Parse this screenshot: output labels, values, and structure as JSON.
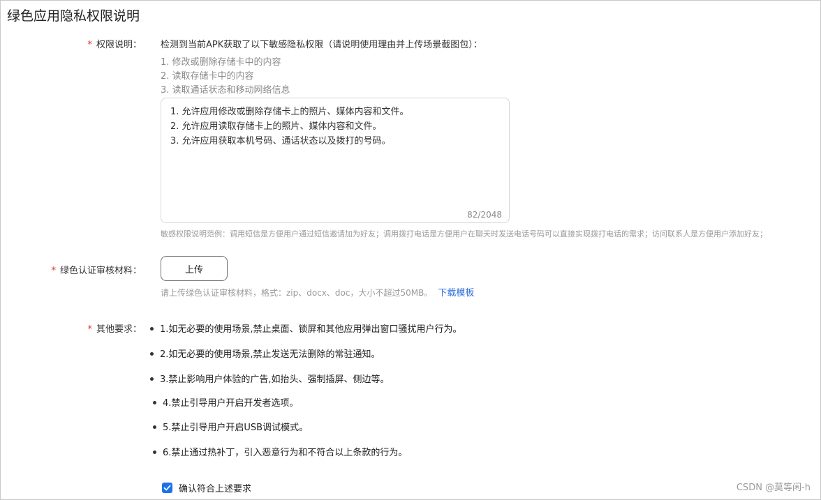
{
  "page": {
    "title": "绿色应用隐私权限说明"
  },
  "permission": {
    "label": "权限说明：",
    "intro": "检测到当前APK获取了以下敏感隐私权限（请说明使用理由并上传场景截图包）：",
    "list": [
      "1. 修改或删除存储卡中的内容",
      "2. 读取存储卡中的内容",
      "3. 读取通话状态和移动网络信息"
    ],
    "textarea_lines": [
      "1. 允许应用修改或删除存储卡上的照片、媒体内容和文件。",
      "2. 允许应用读取存储卡上的照片、媒体内容和文件。",
      "3. 允许应用获取本机号码、通话状态以及拨打的号码。"
    ],
    "char_count": "82/2048",
    "example": "敏感权限说明范例：调用短信是方便用户通过短信邀请加为好友；调用拨打电话是方便用户在聊天时发送电话号码可以直接实现拨打电话的需求；访问联系人是方便用户添加好友；"
  },
  "material": {
    "label": "绿色认证审核材料：",
    "upload_label": "上传",
    "hint": "请上传绿色认证审核材料，格式：zip、docx、doc，大小不超过50MB。",
    "download_label": "下载模板"
  },
  "other": {
    "label": "其他要求：",
    "items": [
      "1.如无必要的使用场景,禁止桌面、锁屏和其他应用弹出窗口骚扰用户行为。",
      "2.如无必要的使用场景,禁止发送无法删除的常驻通知。",
      "3.禁止影响用户体验的广告,如抬头、强制插屏、侧边等。",
      "4.禁止引导用户开启开发者选项。",
      "5.禁止引导用户开启USB调试模式。",
      "6.禁止通过热补丁，引入恶意行为和不符合以上条款的行为。"
    ]
  },
  "confirm": {
    "label": "确认符合上述要求",
    "checked": true
  },
  "required_mark": "*",
  "watermark": "CSDN @莫等闲-h",
  "colors": {
    "required": "#e0352b",
    "link": "#2c6bd6",
    "checkbox": "#1a73e8"
  },
  "icons": {
    "checkbox": "check-icon"
  }
}
